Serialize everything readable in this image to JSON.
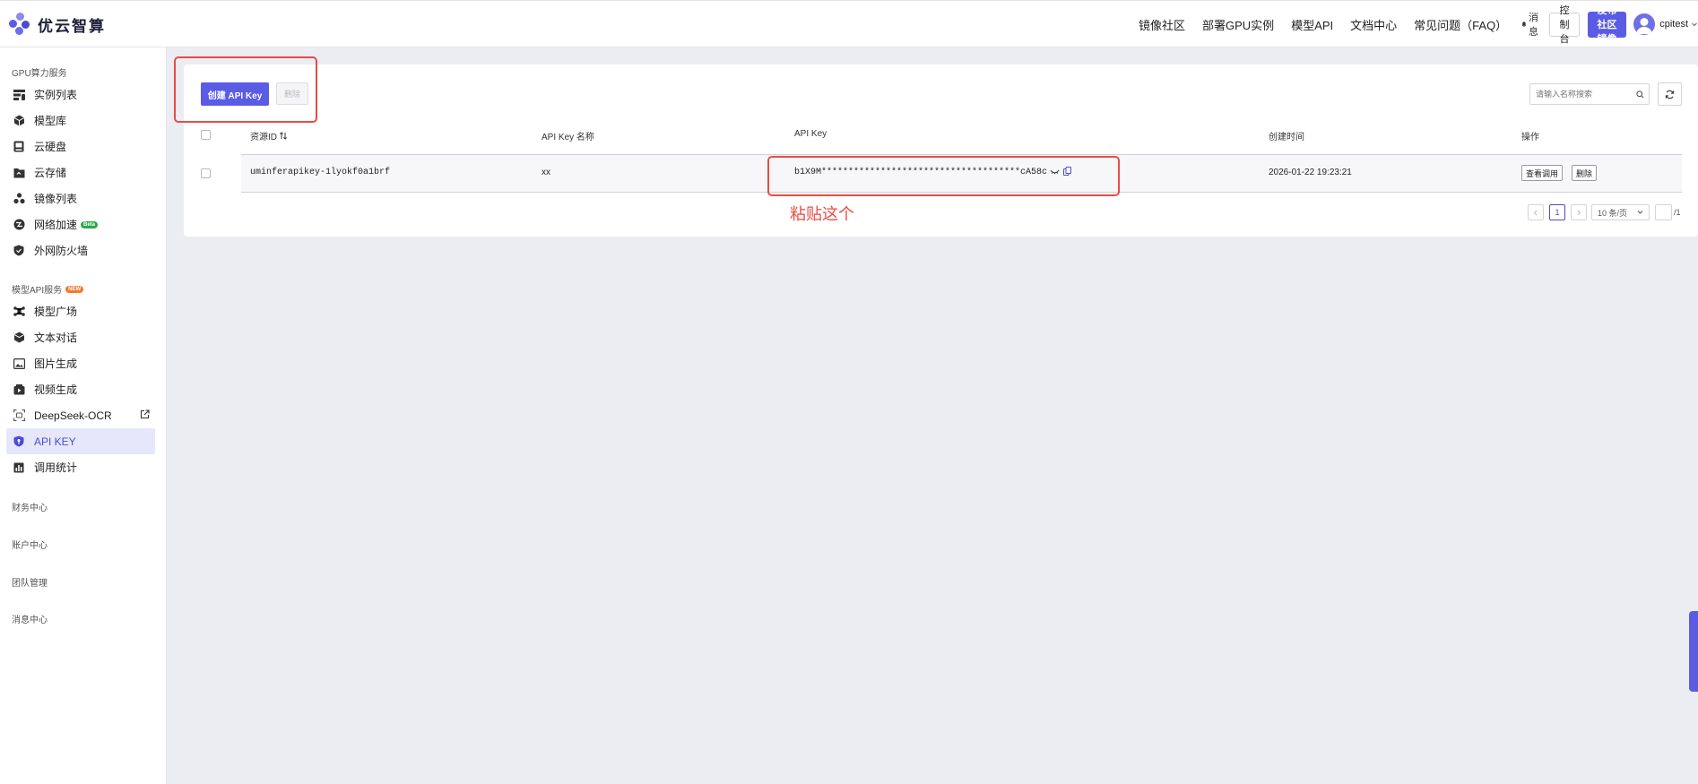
{
  "brand": {
    "name": "优云智算"
  },
  "topnav": {
    "links": [
      "镜像社区",
      "部署GPU实例",
      "模型API",
      "文档中心",
      "常见问题（FAQ）"
    ],
    "message": "消息",
    "console": "控制台",
    "publish": "发布社区镜像",
    "username": "cpitest"
  },
  "sidebar": {
    "gpu_section": "GPU算力服务",
    "gpu_items": [
      "实例列表",
      "模型库",
      "云硬盘",
      "云存储",
      "镜像列表",
      "网络加速",
      "外网防火墙"
    ],
    "beta_badge": "Beta",
    "api_section": "模型API服务",
    "new_badge": "NEW",
    "api_items": [
      "模型广场",
      "文本对话",
      "图片生成",
      "视频生成",
      "DeepSeek-OCR",
      "API KEY",
      "调用统计"
    ],
    "bottom_sections": [
      "财务中心",
      "账户中心",
      "团队管理",
      "消息中心"
    ]
  },
  "toolbar": {
    "create_label": "创建 API Key",
    "delete_label": "删除",
    "search_placeholder": "请输入名称搜索"
  },
  "table": {
    "headers": [
      "资源ID",
      "API Key 名称",
      "API Key",
      "创建时间",
      "操作"
    ],
    "rows": [
      {
        "resource_id": "uminferapikey-1lyokf0a1brf",
        "name": "xx",
        "api_key": "b1X9M*************************************cA58c",
        "created": "2026-01-22 19:23:21",
        "actions": [
          "查看调用",
          "删除"
        ]
      }
    ]
  },
  "annotation": {
    "text": "粘贴这个"
  },
  "pagination": {
    "current": "1",
    "page_size": "10 条/页",
    "total_pages": "/1"
  },
  "colors": {
    "accent": "#5b5ce5",
    "annotation": "#e84c44",
    "active_bg": "#e6e7fb"
  }
}
